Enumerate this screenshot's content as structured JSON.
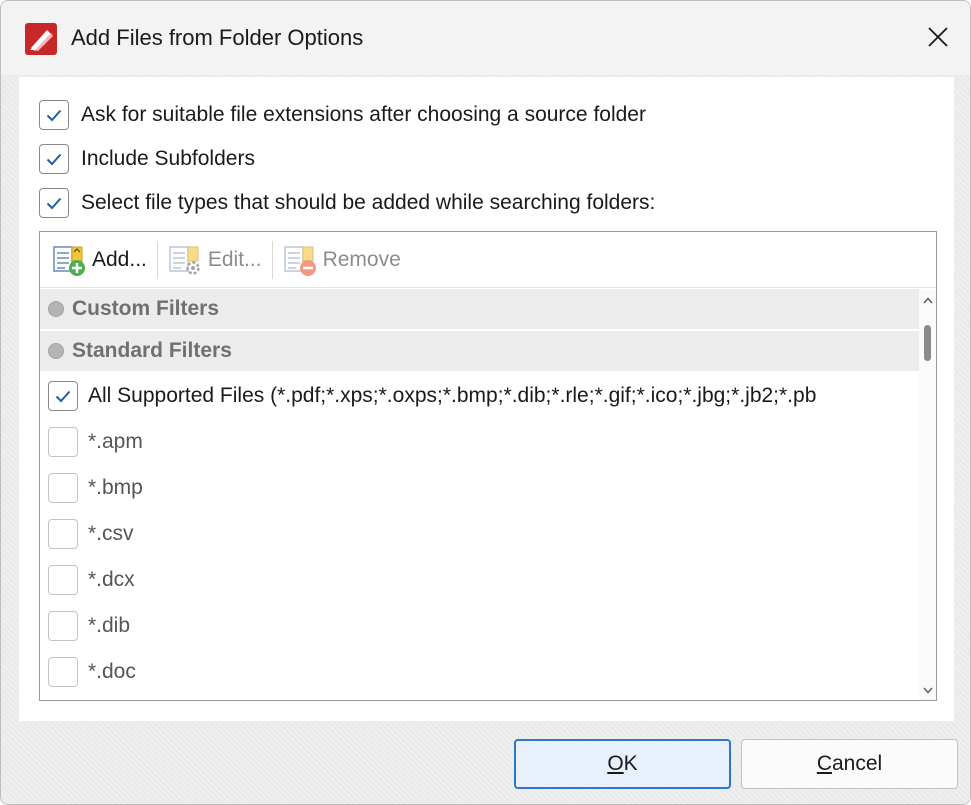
{
  "window": {
    "title": "Add Files from Folder Options",
    "icon": "pdf-app-icon"
  },
  "options": [
    {
      "label": "Ask for suitable file extensions after choosing a source folder",
      "checked": true
    },
    {
      "label": "Include Subfolders",
      "checked": true
    },
    {
      "label": "Select file types that should be added while searching folders:",
      "checked": true
    }
  ],
  "toolbar": {
    "add_label": "Add...",
    "edit_label": "Edit...",
    "remove_label": "Remove"
  },
  "filters": {
    "groups": {
      "custom": "Custom Filters",
      "standard": "Standard Filters"
    },
    "items": [
      {
        "label": "All Supported Files (*.pdf;*.xps;*.oxps;*.bmp;*.dib;*.rle;*.gif;*.ico;*.jbg;*.jb2;*.pb",
        "checked": true
      },
      {
        "label": "*.apm",
        "checked": false
      },
      {
        "label": "*.bmp",
        "checked": false
      },
      {
        "label": "*.csv",
        "checked": false
      },
      {
        "label": "*.dcx",
        "checked": false
      },
      {
        "label": "*.dib",
        "checked": false
      },
      {
        "label": "*.doc",
        "checked": false
      }
    ]
  },
  "buttons": {
    "ok": {
      "mnemonic": "O",
      "rest": "K"
    },
    "cancel": {
      "mnemonic": "C",
      "rest": "ancel"
    }
  },
  "colors": {
    "accent": "#2b77c9",
    "check": "#1f5fa8",
    "app_icon": "#c62828"
  }
}
